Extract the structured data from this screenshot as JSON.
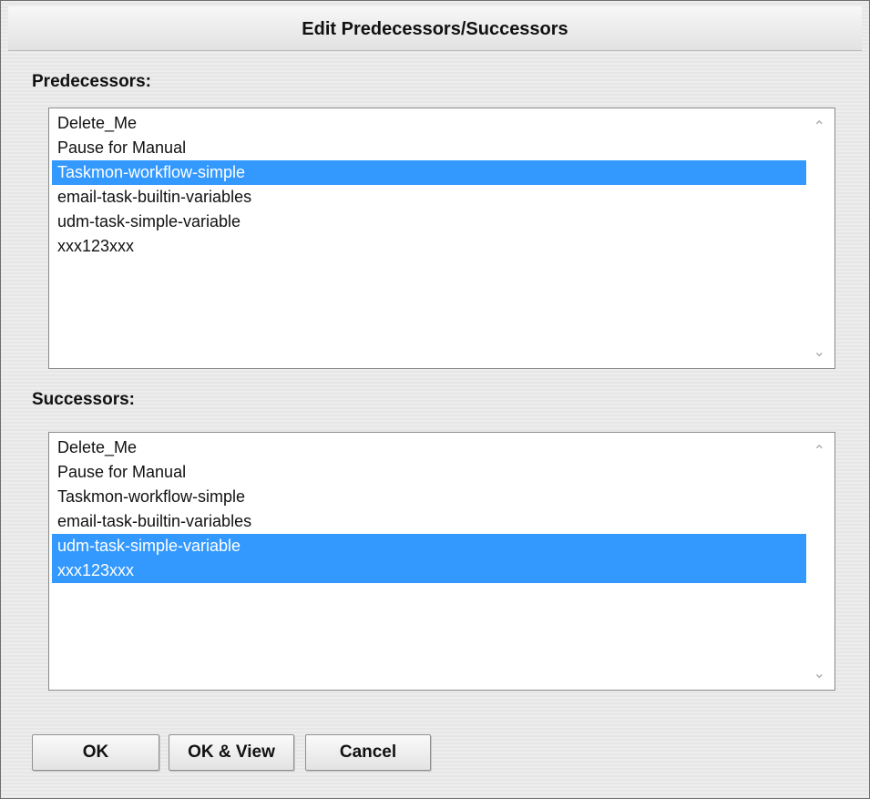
{
  "dialog": {
    "title": "Edit Predecessors/Successors"
  },
  "predecessors": {
    "label": "Predecessors:",
    "items": [
      {
        "text": "Delete_Me",
        "selected": false
      },
      {
        "text": "Pause for Manual",
        "selected": false
      },
      {
        "text": "Taskmon-workflow-simple",
        "selected": true
      },
      {
        "text": "email-task-builtin-variables",
        "selected": false
      },
      {
        "text": "udm-task-simple-variable",
        "selected": false
      },
      {
        "text": "xxx123xxx",
        "selected": false
      }
    ]
  },
  "successors": {
    "label": "Successors:",
    "items": [
      {
        "text": "Delete_Me",
        "selected": false
      },
      {
        "text": "Pause for Manual",
        "selected": false
      },
      {
        "text": "Taskmon-workflow-simple",
        "selected": false
      },
      {
        "text": "email-task-builtin-variables",
        "selected": false
      },
      {
        "text": "udm-task-simple-variable",
        "selected": true
      },
      {
        "text": "xxx123xxx",
        "selected": true
      }
    ]
  },
  "buttons": {
    "ok": "OK",
    "ok_view": "OK & View",
    "cancel": "Cancel"
  },
  "icons": {
    "scroll_up": "chevron-up-icon",
    "scroll_down": "chevron-down-icon"
  },
  "colors": {
    "selection": "#3399ff",
    "selection_text": "#ffffff"
  }
}
